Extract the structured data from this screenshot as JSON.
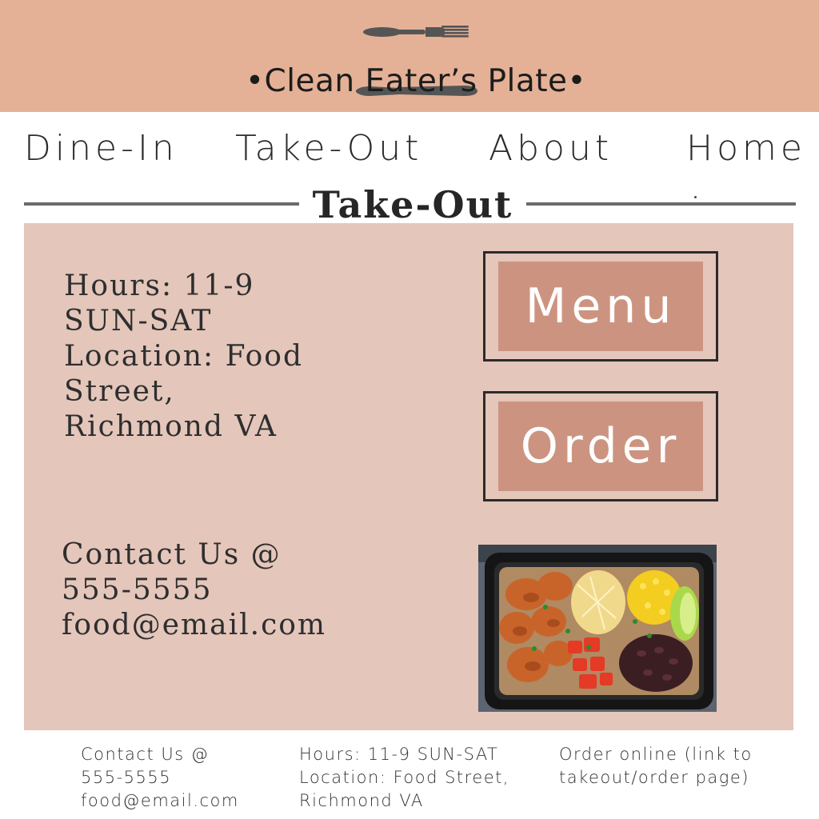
{
  "header": {
    "brand_name": "•Clean Eater’s Plate•",
    "icons": [
      "fork-icon",
      "knife-icon"
    ]
  },
  "nav": {
    "items": [
      {
        "label": "Dine-In"
      },
      {
        "label": "Take-Out"
      },
      {
        "label": "About"
      },
      {
        "label": "Home"
      }
    ]
  },
  "section": {
    "title": "Take-Out"
  },
  "info": {
    "hours_line": "Hours: 11-9",
    "days_line": "SUN-SAT",
    "location_line1": "Location: Food",
    "location_line2": "Street,",
    "location_line3": "Richmond VA"
  },
  "contact": {
    "heading": "Contact Us @",
    "phone": "555-5555",
    "email": "food@email.com"
  },
  "buttons": {
    "menu_label": "Menu",
    "order_label": "Order"
  },
  "footer": {
    "contact_heading": "Contact Us @",
    "contact_phone": "555-5555",
    "contact_email": "food@email.com",
    "hours_line": "Hours: 11-9 SUN-SAT",
    "location_line1": "Location: Food Street,",
    "location_line2": "Richmond VA",
    "order_line1": "Order online (link to",
    "order_line2": "takeout/order page)"
  },
  "colors": {
    "banner": "#e4b196",
    "panel": "#e4c6bb",
    "button_fill": "#cc9480",
    "rule": "#6b6b6b"
  }
}
